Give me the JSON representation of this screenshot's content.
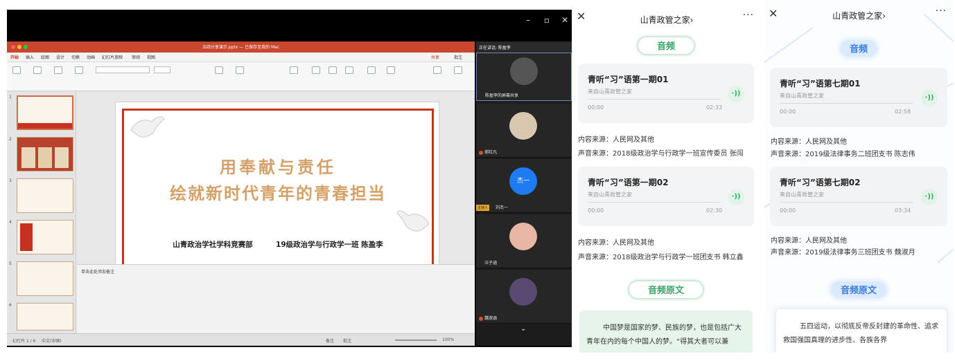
{
  "meeting": {
    "speaking_label": "正在讲话: 陈盈李",
    "ppt": {
      "window_title": "五四分享演示.pptx — 已保存至我的 Mac",
      "ribbon_tabs": [
        "开始",
        "插入",
        "绘图",
        "设计",
        "切换",
        "动画",
        "幻灯片放映",
        "审阅",
        "视图"
      ],
      "share_label": "共享",
      "comment_label": "批注",
      "slide_title_line1": "用奉献与责任",
      "slide_title_line2": "绘就新时代青年的青春担当",
      "slide_subtitle_left": "山青政治学社学科竞赛部",
      "slide_subtitle_right": "19级政治学与行政学一班 陈盈李",
      "notes_placeholder": "单击此处添加备注",
      "status_slide": "幻灯片 1 / 6",
      "status_lang": "中文(中国)",
      "status_notes": "备注",
      "status_comments": "批注",
      "zoom": "100%",
      "thumb_numbers": [
        "1",
        "2",
        "3",
        "4",
        "5",
        "6"
      ]
    },
    "participants": [
      {
        "name": "陈盈李的屏幕共享"
      },
      {
        "name": "郝红凡"
      },
      {
        "name": "刘杰一",
        "avatar_text": "杰一",
        "badge": "主持人"
      },
      {
        "name": "汪子涵"
      },
      {
        "name": "魏淑涵"
      }
    ]
  },
  "phone1": {
    "title": "山青政管之家",
    "section1": "音频",
    "cards": [
      {
        "title": "青听“习”语第一期01",
        "from": "来自山青政管之家",
        "start": "00:00",
        "end": "02:33"
      },
      {
        "title": "青听“习”语第一期02",
        "from": "来自山青政管之家",
        "start": "00:00",
        "end": "02:30"
      }
    ],
    "info": [
      {
        "content_source": "内容来源：人民网及其他",
        "audio_source": "声音来源：2018级政治学与行政学一班宣传委员 张闯"
      },
      {
        "content_source": "内容来源：人民网及其他",
        "audio_source": "声音来源：2018级政治学与行政学一班团支书 韩立鑫"
      }
    ],
    "section2": "音频原文",
    "original_text": "中国梦是国家的梦、民族的梦，也是包括广大青年在内的每个中国人的梦。“得其大者可以兼"
  },
  "phone2": {
    "title": "山青政管之家",
    "section1": "音频",
    "cards": [
      {
        "title": "青听“习”语第七期01",
        "from": "来自山青政管之家",
        "start": "00:00",
        "end": "02:58"
      },
      {
        "title": "青听“习”语第七期02",
        "from": "来自山青政管之家",
        "start": "00:00",
        "end": "03:34"
      }
    ],
    "info": [
      {
        "content_source": "内容来源：人民网及其他",
        "audio_source": "声音来源：2019级法律事务二班团支书 陈志伟"
      },
      {
        "content_source": "内容来源：人民网及其他",
        "audio_source": "声音来源：2019级法律事务三班团支书 魏淑月"
      }
    ],
    "section2": "音频原文",
    "original_text": "五四运动，以彻底反帝反封建的革命性、追求救国强国真理的进步性、各族各界"
  },
  "colors": {
    "ppt_red": "#c5321d",
    "slide_gold": "#d4a268",
    "green_accent": "#3aa467",
    "blue_accent": "#3a7ed8"
  }
}
